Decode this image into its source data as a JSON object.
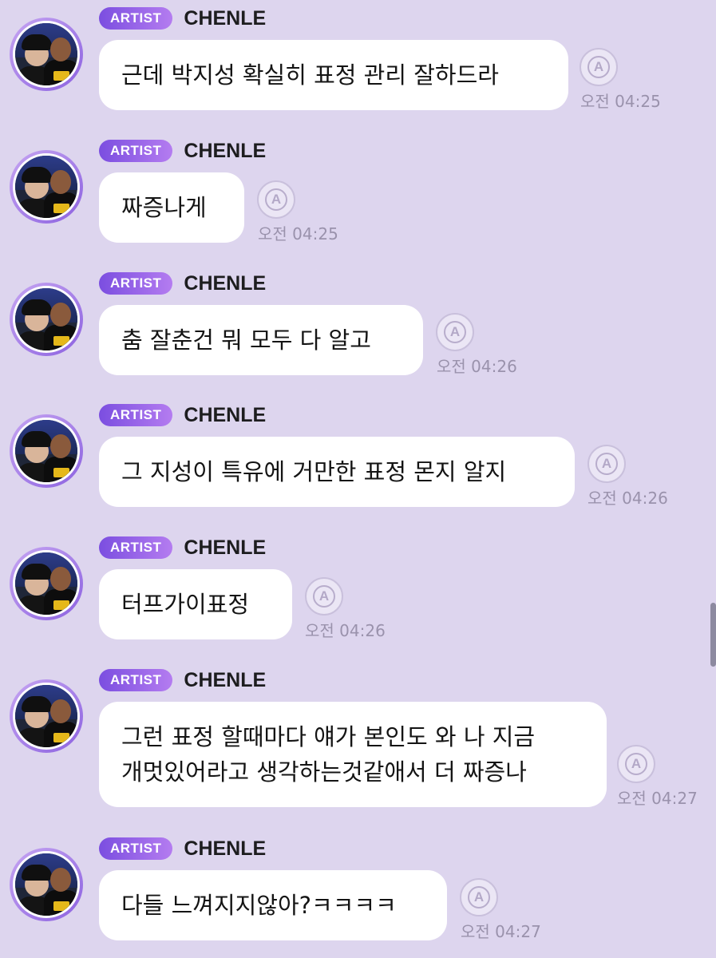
{
  "badge_label": "ARTIST",
  "sender_name": "CHENLE",
  "translate_icon_letter": "A",
  "messages": [
    {
      "text": "근데 박지성 확실히 표정 관리 잘하드라",
      "time": "오전 04:25"
    },
    {
      "text": "짜증나게",
      "time": "오전 04:25"
    },
    {
      "text": "춤 잘춘건 뭐 모두 다 알고",
      "time": "오전 04:26"
    },
    {
      "text": "그 지성이 특유에 거만한 표정 몬지 알지",
      "time": "오전 04:26"
    },
    {
      "text": "터프가이표정",
      "time": "오전 04:26"
    },
    {
      "text": "그런 표정 할때마다 얘가 본인도 와 나 지금\n개멋있어라고 생각하는것같애서 더 짜증나",
      "time": "오전 04:27"
    },
    {
      "text": "다들 느껴지지않아?ㅋㅋㅋㅋ",
      "time": "오전 04:27"
    }
  ]
}
